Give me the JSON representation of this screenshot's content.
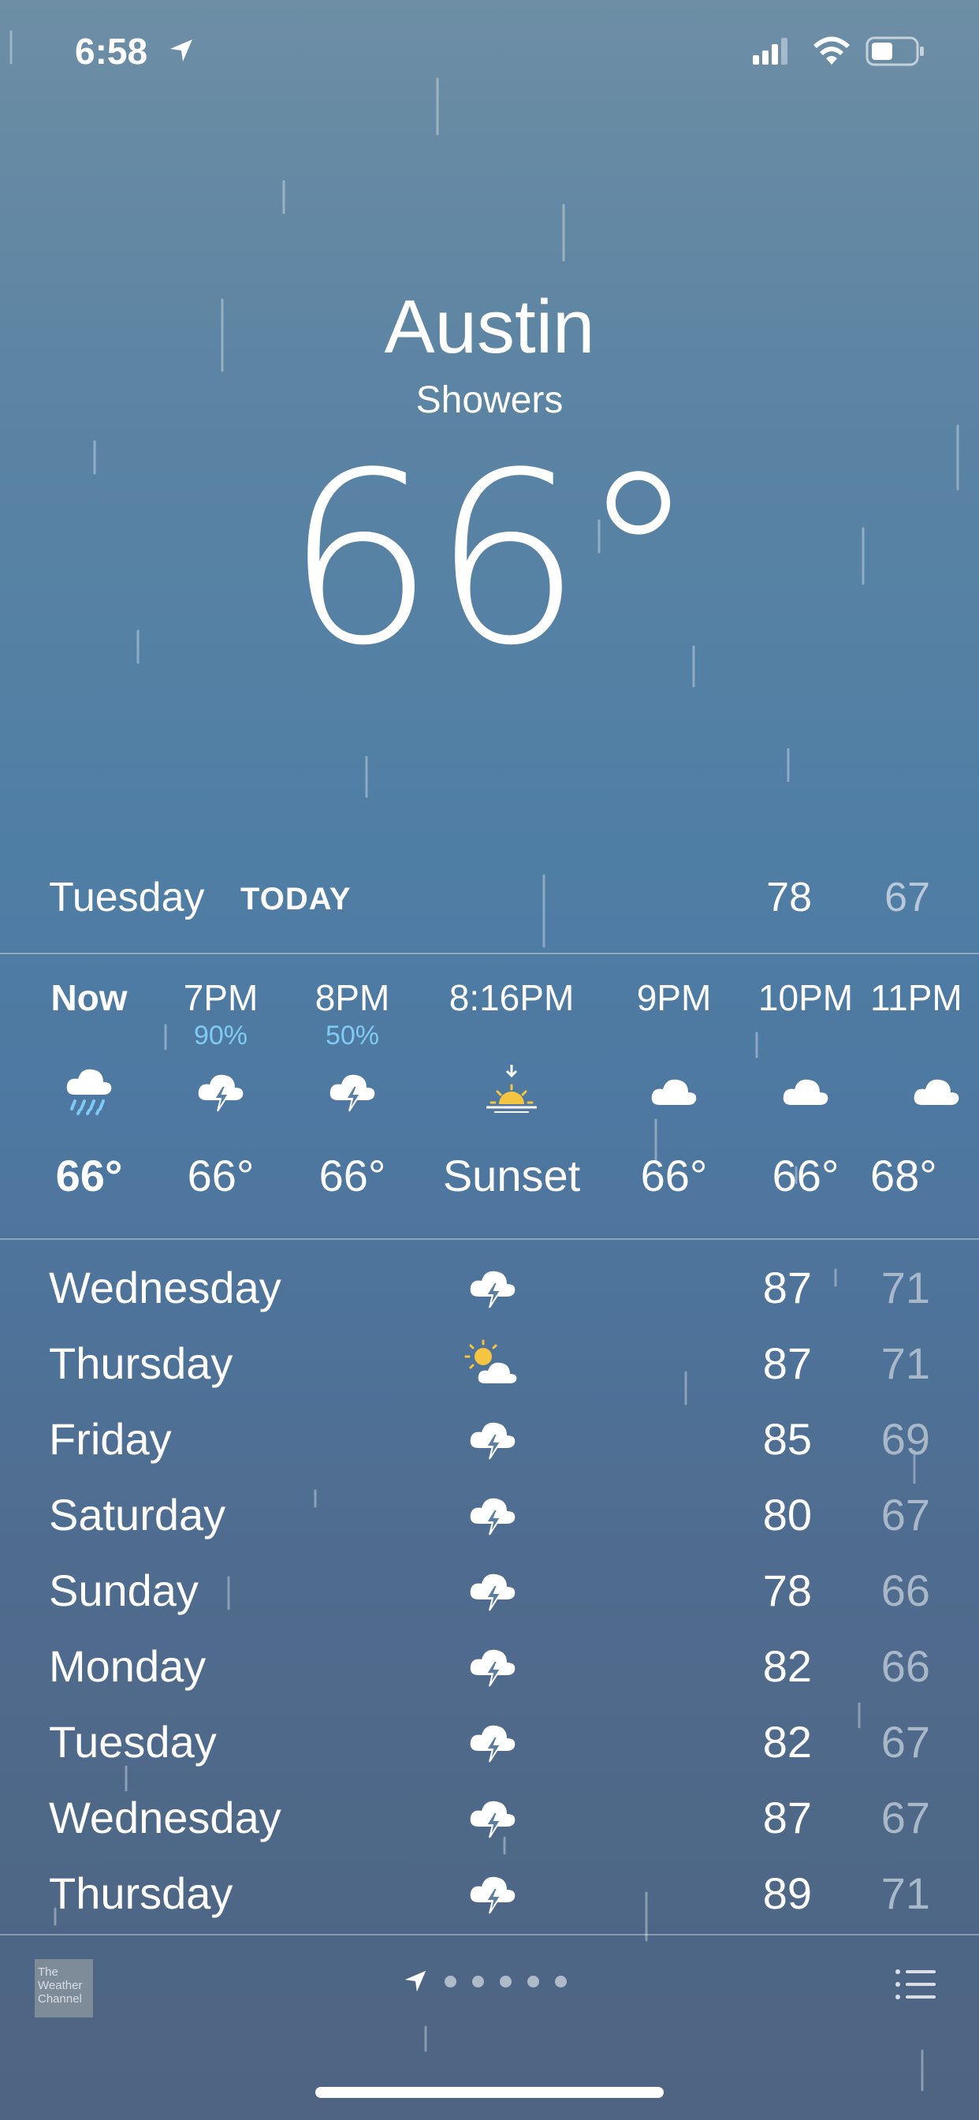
{
  "status_bar": {
    "time": "6:58"
  },
  "header": {
    "city": "Austin",
    "condition": "Showers",
    "temperature": "66°"
  },
  "today": {
    "day": "Tuesday",
    "label": "TODAY",
    "high": "78",
    "low": "67"
  },
  "hourly": [
    {
      "time": "Now",
      "pop": "",
      "icon": "rain-cloud-icon",
      "temp": "66°"
    },
    {
      "time": "7PM",
      "pop": "90%",
      "icon": "thunderstorm-icon",
      "temp": "66°"
    },
    {
      "time": "8PM",
      "pop": "50%",
      "icon": "thunderstorm-icon",
      "temp": "66°"
    },
    {
      "time": "8:16PM",
      "pop": "",
      "icon": "sunset-icon",
      "temp": "Sunset"
    },
    {
      "time": "9PM",
      "pop": "",
      "icon": "cloud-icon",
      "temp": "66°"
    },
    {
      "time": "10PM",
      "pop": "",
      "icon": "cloud-icon",
      "temp": "66°"
    },
    {
      "time": "11PM",
      "pop": "",
      "icon": "cloud-icon",
      "temp": "68°"
    }
  ],
  "daily": [
    {
      "day": "Wednesday",
      "icon": "thunderstorm-icon",
      "high": "87",
      "low": "71"
    },
    {
      "day": "Thursday",
      "icon": "partly-sunny-icon",
      "high": "87",
      "low": "71"
    },
    {
      "day": "Friday",
      "icon": "thunderstorm-icon",
      "high": "85",
      "low": "69"
    },
    {
      "day": "Saturday",
      "icon": "thunderstorm-icon",
      "high": "80",
      "low": "67"
    },
    {
      "day": "Sunday",
      "icon": "thunderstorm-icon",
      "high": "78",
      "low": "66"
    },
    {
      "day": "Monday",
      "icon": "thunderstorm-icon",
      "high": "82",
      "low": "66"
    },
    {
      "day": "Tuesday",
      "icon": "thunderstorm-icon",
      "high": "82",
      "low": "67"
    },
    {
      "day": "Wednesday",
      "icon": "thunderstorm-icon",
      "high": "87",
      "low": "67"
    },
    {
      "day": "Thursday",
      "icon": "thunderstorm-icon",
      "high": "89",
      "low": "71"
    }
  ],
  "footer": {
    "logo_text": "The Weather Channel",
    "page_count": 5,
    "current_page": "location"
  },
  "colors": {
    "precip": "#7fcaf5",
    "sun": "#f5c542",
    "low_temp": "#a8b8c8"
  }
}
